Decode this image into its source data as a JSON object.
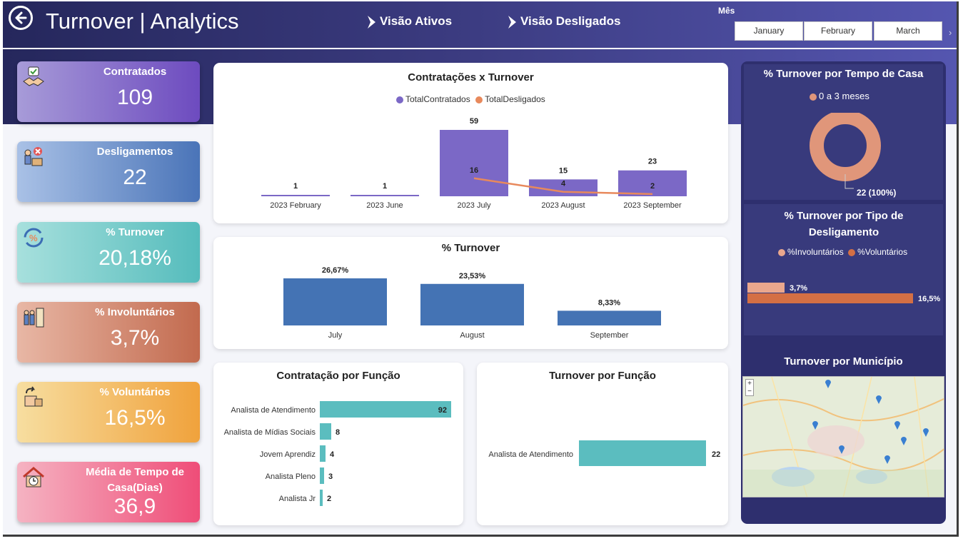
{
  "header": {
    "title": "Turnover | Analytics",
    "nav": [
      "Visão Ativos",
      "Visão Desligados"
    ],
    "month_label": "Mês",
    "months": [
      "January",
      "February",
      "March"
    ]
  },
  "kpis": [
    {
      "label": "Contratados",
      "value": "109"
    },
    {
      "label": "Desligamentos",
      "value": "22"
    },
    {
      "label": "% Turnover",
      "value": "20,18%"
    },
    {
      "label": "% Involuntários",
      "value": "3,7%"
    },
    {
      "label": "% Voluntários",
      "value": "16,5%"
    },
    {
      "label": "Média de Tempo de Casa(Dias)",
      "value": "36,9"
    }
  ],
  "colors": {
    "purple": "#7b68c6",
    "orange": "#e8895c",
    "blue": "#4473b4",
    "teal": "#5bbdbf"
  },
  "chart_data": [
    {
      "type": "bar",
      "title": "Contratações x Turnover",
      "categories": [
        "2023 February",
        "2023 June",
        "2023 July",
        "2023 August",
        "2023 September"
      ],
      "series": [
        {
          "name": "TotalContratados",
          "type": "bar",
          "values": [
            1,
            1,
            59,
            15,
            23
          ]
        },
        {
          "name": "TotalDesligados",
          "type": "line",
          "values": [
            null,
            null,
            16,
            4,
            2
          ]
        }
      ],
      "legend": "top-center"
    },
    {
      "type": "bar",
      "title": "% Turnover",
      "categories": [
        "July",
        "August",
        "September"
      ],
      "values": [
        26.67
      ],
      "values_all": [
        26.67,
        23.53,
        8.33
      ],
      "labels": [
        "26,67%",
        "23,53%",
        "8,33%"
      ]
    },
    {
      "type": "bar",
      "orientation": "horizontal",
      "title": "Contratação por Função",
      "categories": [
        "Analista de Atendimento",
        "Analista de Mídias Sociais",
        "Jovem Aprendiz",
        "Analista Pleno",
        "Analista Jr"
      ],
      "values": [
        92,
        8,
        4,
        3,
        2
      ]
    },
    {
      "type": "bar",
      "orientation": "horizontal",
      "title": "Turnover por Função",
      "categories": [
        "Analista de Atendimento"
      ],
      "values": [
        22
      ]
    },
    {
      "type": "pie",
      "title": "% Turnover por Tempo de Casa",
      "categories": [
        "0 a 3 meses"
      ],
      "values": [
        22
      ],
      "labels": [
        "22 (100%)"
      ]
    },
    {
      "type": "bar",
      "orientation": "horizontal",
      "title": "% Turnover por Tipo de Desligamento",
      "series": [
        {
          "name": "%Involuntários",
          "values": [
            3.7
          ],
          "label": "3,7%"
        },
        {
          "name": "%Voluntários",
          "values": [
            16.5
          ],
          "label": "16,5%"
        }
      ]
    }
  ],
  "map": {
    "title": "Turnover por Município",
    "zoom_in": "+",
    "zoom_out": "−"
  }
}
